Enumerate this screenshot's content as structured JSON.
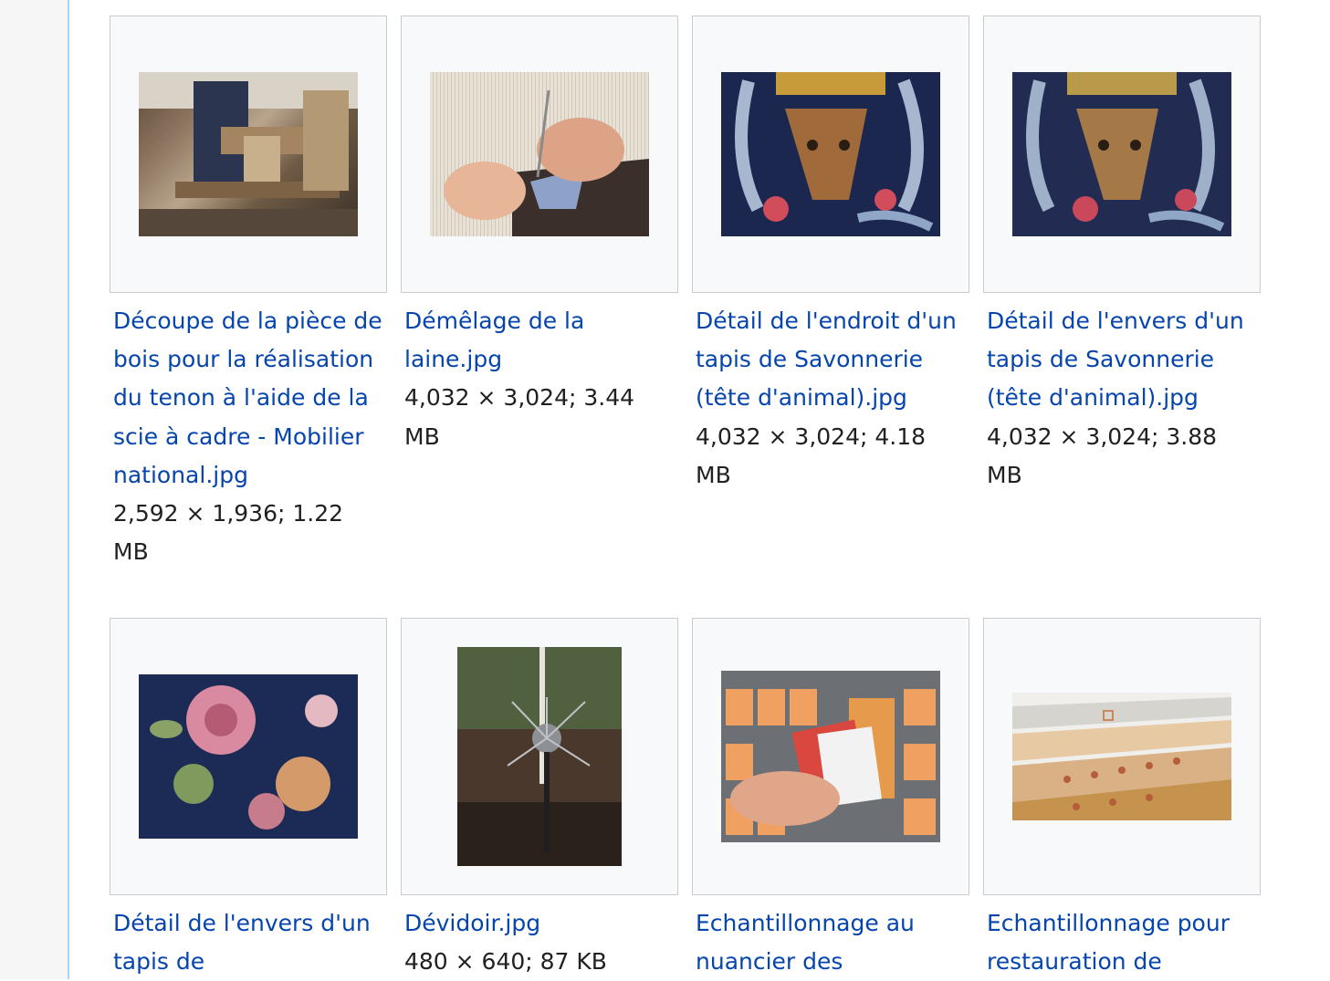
{
  "gallery": {
    "items": [
      {
        "filename": "Découpe de la pièce de bois pour la réalisation du tenon à l'aide de la scie à cadre - Mobilier national.jpg",
        "meta": "2,592 × 1,936; 1.22 MB"
      },
      {
        "filename": "Démêlage de la laine.jpg",
        "meta": "4,032 × 3,024; 3.44 MB"
      },
      {
        "filename": "Détail de l'endroit d'un tapis de Savonnerie (tête d'animal).jpg",
        "meta": "4,032 × 3,024; 4.18 MB"
      },
      {
        "filename": "Détail de l'envers d'un tapis de Savonnerie (tête d'animal).jpg",
        "meta": "4,032 × 3,024; 3.88 MB"
      },
      {
        "filename": "Détail de l'envers d'un tapis de",
        "meta": ""
      },
      {
        "filename": "Dévidoir.jpg",
        "meta": "480 × 640; 87 KB"
      },
      {
        "filename": "Echantillonnage au nuancier des",
        "meta": ""
      },
      {
        "filename": "Echantillonnage pour restauration de",
        "meta": ""
      }
    ]
  }
}
